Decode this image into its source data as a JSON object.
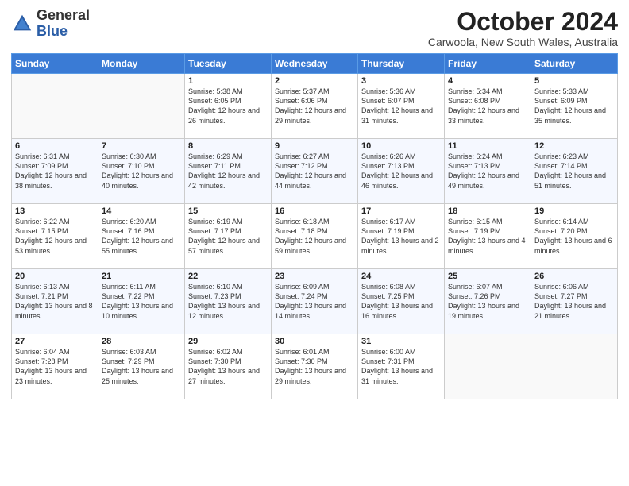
{
  "header": {
    "logo_general": "General",
    "logo_blue": "Blue",
    "month_year": "October 2024",
    "location": "Carwoola, New South Wales, Australia"
  },
  "days_of_week": [
    "Sunday",
    "Monday",
    "Tuesday",
    "Wednesday",
    "Thursday",
    "Friday",
    "Saturday"
  ],
  "weeks": [
    [
      {
        "day": "",
        "detail": ""
      },
      {
        "day": "",
        "detail": ""
      },
      {
        "day": "1",
        "detail": "Sunrise: 5:38 AM\nSunset: 6:05 PM\nDaylight: 12 hours\nand 26 minutes."
      },
      {
        "day": "2",
        "detail": "Sunrise: 5:37 AM\nSunset: 6:06 PM\nDaylight: 12 hours\nand 29 minutes."
      },
      {
        "day": "3",
        "detail": "Sunrise: 5:36 AM\nSunset: 6:07 PM\nDaylight: 12 hours\nand 31 minutes."
      },
      {
        "day": "4",
        "detail": "Sunrise: 5:34 AM\nSunset: 6:08 PM\nDaylight: 12 hours\nand 33 minutes."
      },
      {
        "day": "5",
        "detail": "Sunrise: 5:33 AM\nSunset: 6:09 PM\nDaylight: 12 hours\nand 35 minutes."
      }
    ],
    [
      {
        "day": "6",
        "detail": "Sunrise: 6:31 AM\nSunset: 7:09 PM\nDaylight: 12 hours\nand 38 minutes."
      },
      {
        "day": "7",
        "detail": "Sunrise: 6:30 AM\nSunset: 7:10 PM\nDaylight: 12 hours\nand 40 minutes."
      },
      {
        "day": "8",
        "detail": "Sunrise: 6:29 AM\nSunset: 7:11 PM\nDaylight: 12 hours\nand 42 minutes."
      },
      {
        "day": "9",
        "detail": "Sunrise: 6:27 AM\nSunset: 7:12 PM\nDaylight: 12 hours\nand 44 minutes."
      },
      {
        "day": "10",
        "detail": "Sunrise: 6:26 AM\nSunset: 7:13 PM\nDaylight: 12 hours\nand 46 minutes."
      },
      {
        "day": "11",
        "detail": "Sunrise: 6:24 AM\nSunset: 7:13 PM\nDaylight: 12 hours\nand 49 minutes."
      },
      {
        "day": "12",
        "detail": "Sunrise: 6:23 AM\nSunset: 7:14 PM\nDaylight: 12 hours\nand 51 minutes."
      }
    ],
    [
      {
        "day": "13",
        "detail": "Sunrise: 6:22 AM\nSunset: 7:15 PM\nDaylight: 12 hours\nand 53 minutes."
      },
      {
        "day": "14",
        "detail": "Sunrise: 6:20 AM\nSunset: 7:16 PM\nDaylight: 12 hours\nand 55 minutes."
      },
      {
        "day": "15",
        "detail": "Sunrise: 6:19 AM\nSunset: 7:17 PM\nDaylight: 12 hours\nand 57 minutes."
      },
      {
        "day": "16",
        "detail": "Sunrise: 6:18 AM\nSunset: 7:18 PM\nDaylight: 12 hours\nand 59 minutes."
      },
      {
        "day": "17",
        "detail": "Sunrise: 6:17 AM\nSunset: 7:19 PM\nDaylight: 13 hours\nand 2 minutes."
      },
      {
        "day": "18",
        "detail": "Sunrise: 6:15 AM\nSunset: 7:19 PM\nDaylight: 13 hours\nand 4 minutes."
      },
      {
        "day": "19",
        "detail": "Sunrise: 6:14 AM\nSunset: 7:20 PM\nDaylight: 13 hours\nand 6 minutes."
      }
    ],
    [
      {
        "day": "20",
        "detail": "Sunrise: 6:13 AM\nSunset: 7:21 PM\nDaylight: 13 hours\nand 8 minutes."
      },
      {
        "day": "21",
        "detail": "Sunrise: 6:11 AM\nSunset: 7:22 PM\nDaylight: 13 hours\nand 10 minutes."
      },
      {
        "day": "22",
        "detail": "Sunrise: 6:10 AM\nSunset: 7:23 PM\nDaylight: 13 hours\nand 12 minutes."
      },
      {
        "day": "23",
        "detail": "Sunrise: 6:09 AM\nSunset: 7:24 PM\nDaylight: 13 hours\nand 14 minutes."
      },
      {
        "day": "24",
        "detail": "Sunrise: 6:08 AM\nSunset: 7:25 PM\nDaylight: 13 hours\nand 16 minutes."
      },
      {
        "day": "25",
        "detail": "Sunrise: 6:07 AM\nSunset: 7:26 PM\nDaylight: 13 hours\nand 19 minutes."
      },
      {
        "day": "26",
        "detail": "Sunrise: 6:06 AM\nSunset: 7:27 PM\nDaylight: 13 hours\nand 21 minutes."
      }
    ],
    [
      {
        "day": "27",
        "detail": "Sunrise: 6:04 AM\nSunset: 7:28 PM\nDaylight: 13 hours\nand 23 minutes."
      },
      {
        "day": "28",
        "detail": "Sunrise: 6:03 AM\nSunset: 7:29 PM\nDaylight: 13 hours\nand 25 minutes."
      },
      {
        "day": "29",
        "detail": "Sunrise: 6:02 AM\nSunset: 7:30 PM\nDaylight: 13 hours\nand 27 minutes."
      },
      {
        "day": "30",
        "detail": "Sunrise: 6:01 AM\nSunset: 7:30 PM\nDaylight: 13 hours\nand 29 minutes."
      },
      {
        "day": "31",
        "detail": "Sunrise: 6:00 AM\nSunset: 7:31 PM\nDaylight: 13 hours\nand 31 minutes."
      },
      {
        "day": "",
        "detail": ""
      },
      {
        "day": "",
        "detail": ""
      }
    ]
  ]
}
